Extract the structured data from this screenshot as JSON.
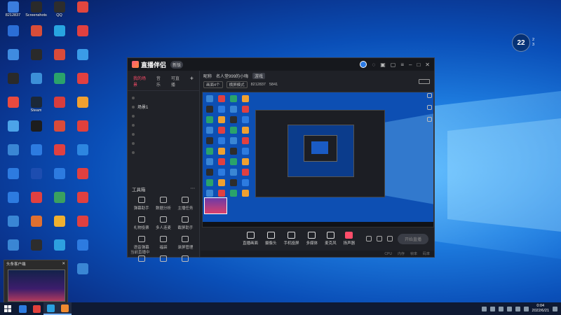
{
  "desktop_icons": [
    {
      "label": "8212837",
      "color": "#3b7ddd"
    },
    {
      "label": "Screenshots",
      "color": "#2a2a2a"
    },
    {
      "label": "QQ",
      "color": "#2d2d2d"
    },
    {
      "label": "",
      "color": "#e0463e"
    },
    {
      "label": "",
      "color": "#2b6ed6"
    },
    {
      "label": "",
      "color": "#d84d39"
    },
    {
      "label": "",
      "color": "#28a5e0"
    },
    {
      "label": "",
      "color": "#e04040"
    },
    {
      "label": "",
      "color": "#3f8be0"
    },
    {
      "label": "",
      "color": "#2a2a2a"
    },
    {
      "label": "",
      "color": "#d94b3a"
    },
    {
      "label": "",
      "color": "#3a9be8"
    },
    {
      "label": "",
      "color": "#2a2a2a"
    },
    {
      "label": "",
      "color": "#3c8fd8"
    },
    {
      "label": "",
      "color": "#2aa36b"
    },
    {
      "label": "",
      "color": "#e04040"
    },
    {
      "label": "",
      "color": "#e94a3f"
    },
    {
      "label": "Steam",
      "color": "#1b2838"
    },
    {
      "label": "",
      "color": "#d83d3d"
    },
    {
      "label": "",
      "color": "#f0a030"
    },
    {
      "label": "",
      "color": "#4ca3e8"
    },
    {
      "label": "",
      "color": "#1d1d1d"
    },
    {
      "label": "",
      "color": "#d94b3a"
    },
    {
      "label": "",
      "color": "#e0403c"
    },
    {
      "label": "",
      "color": "#3a86d4"
    },
    {
      "label": "",
      "color": "#2d7be0"
    },
    {
      "label": "",
      "color": "#e04040"
    },
    {
      "label": "",
      "color": "#2d86e0"
    },
    {
      "label": "",
      "color": "#2d7be0"
    },
    {
      "label": "",
      "color": "#1d4db0"
    },
    {
      "label": "",
      "color": "#2d7be0"
    },
    {
      "label": "",
      "color": "#e04040"
    },
    {
      "label": "",
      "color": "#2d7be0"
    },
    {
      "label": "",
      "color": "#e04040"
    },
    {
      "label": "",
      "color": "#3aa060"
    },
    {
      "label": "",
      "color": "#e04040"
    },
    {
      "label": "",
      "color": "#3a86d4"
    },
    {
      "label": "",
      "color": "#e07030"
    },
    {
      "label": "",
      "color": "#f0b030"
    },
    {
      "label": "",
      "color": "#e04040"
    },
    {
      "label": "",
      "color": "#3a86d4"
    },
    {
      "label": "",
      "color": "#2d2d2d"
    },
    {
      "label": "",
      "color": "#2da0e0"
    },
    {
      "label": "",
      "color": "#2d7be0"
    },
    {
      "label": "",
      "color": "#3a86d4"
    },
    {
      "label": "",
      "color": "#e04040"
    },
    {
      "label": "",
      "color": "#2d2d2d"
    },
    {
      "label": "",
      "color": "#3a86d4"
    }
  ],
  "weather": {
    "temp": "22",
    "line1": "2",
    "line2": "3"
  },
  "app": {
    "title": "直播伴侣",
    "version": "新版",
    "left_tabs": [
      "我的场景",
      "音乐",
      "可直播"
    ],
    "scenes": [
      "场景1"
    ],
    "tools_title": "工具箱",
    "tools": [
      "弹幕助手",
      "数据分析",
      "主播任务",
      "礼物投票",
      "多人连麦",
      "截屏助手",
      "语音弹幕",
      "福袋",
      "录屏管理",
      "",
      "",
      ""
    ],
    "notice": "当前直播中"
  },
  "info": {
    "title_label": "昵称",
    "name": "名人堂999的小嗨",
    "tag": "游戏",
    "red": "",
    "stream_label": "画面4个",
    "mode_label": "横屏模式",
    "room": "8212837",
    "fans": "5841"
  },
  "bottom_buttons": [
    "直播画面",
    "摄像头",
    "手机投屏",
    "多媒体",
    "麦克风",
    "扬声器"
  ],
  "go_live": "开始直播",
  "status_items": [
    "CPU",
    "内存",
    "帧率",
    "码率"
  ],
  "popup": {
    "title": "头条客户端"
  },
  "taskbar": {
    "time": "0:04",
    "date": "2022/6/21"
  }
}
